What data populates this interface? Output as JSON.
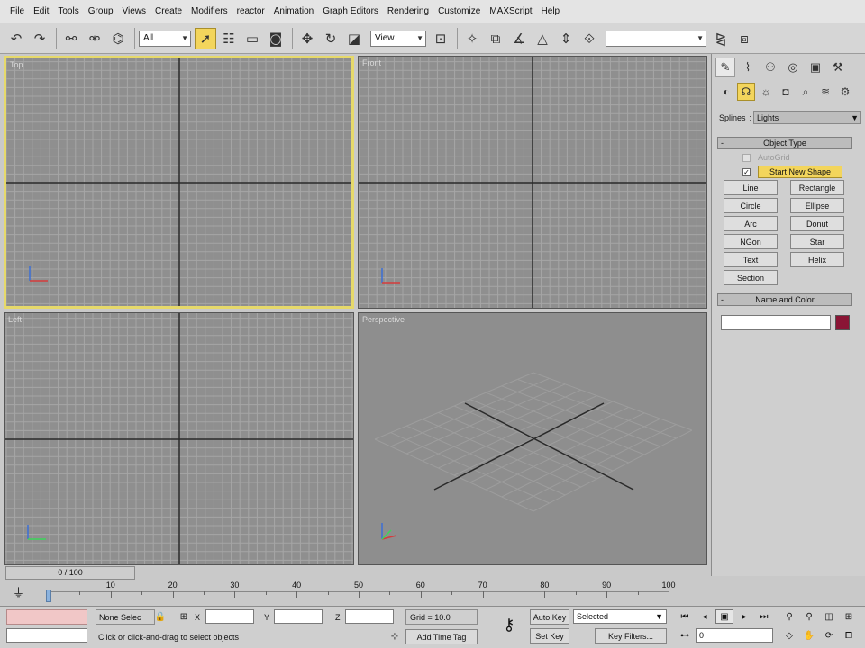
{
  "menu": [
    "File",
    "Edit",
    "Tools",
    "Group",
    "Views",
    "Create",
    "Modifiers",
    "reactor",
    "Animation",
    "Graph Editors",
    "Rendering",
    "Customize",
    "MAXScript",
    "Help"
  ],
  "toolbar": {
    "selection_filter": "All",
    "ref_coord": "View",
    "named_selection": "",
    "icons_left": [
      "undo-icon",
      "redo-icon",
      "select-and-link-icon",
      "unlink-icon",
      "bind-space-warp-icon"
    ],
    "icons_mid": [
      "select-object-icon",
      "select-by-name-icon",
      "rectangular-selection-icon",
      "window-crossing-icon",
      "select-and-move-icon",
      "select-and-rotate-icon",
      "select-and-scale-icon"
    ],
    "icons_right": [
      "use-pivot-center-icon",
      "select-manipulate-icon",
      "snaps-toggle-icon",
      "angle-snap-icon",
      "percent-snap-icon",
      "spinner-snap-icon",
      "edit-named-selection-icon",
      "mirror-icon",
      "align-icon"
    ]
  },
  "viewports": {
    "top": "Top",
    "front": "Front",
    "left": "Left",
    "perspective": "Perspective"
  },
  "command_panel": {
    "category_label": "Splines",
    "category_value": "Lights",
    "object_type_title": "Object Type",
    "autogrid": "AutoGrid",
    "start_new_shape": "Start New Shape",
    "buttons": [
      "Line",
      "Rectangle",
      "Circle",
      "Ellipse",
      "Arc",
      "Donut",
      "NGon",
      "Star",
      "Text",
      "Helix",
      "Section"
    ],
    "name_color_title": "Name and Color",
    "color": "#8a1535"
  },
  "timeline": {
    "slider": "0 / 100",
    "ticks": [
      10,
      20,
      30,
      40,
      50,
      60,
      70,
      80,
      90,
      100
    ]
  },
  "status": {
    "selection": "None Selec",
    "x_label": "X",
    "y_label": "Y",
    "z_label": "Z",
    "grid": "Grid = 10.0",
    "prompt": "Click or click-and-drag to select objects",
    "add_time_tag": "Add Time Tag",
    "auto_key": "Auto Key",
    "set_key": "Set Key",
    "key_mode": "Selected",
    "key_filters": "Key Filters...",
    "frame": "0"
  }
}
